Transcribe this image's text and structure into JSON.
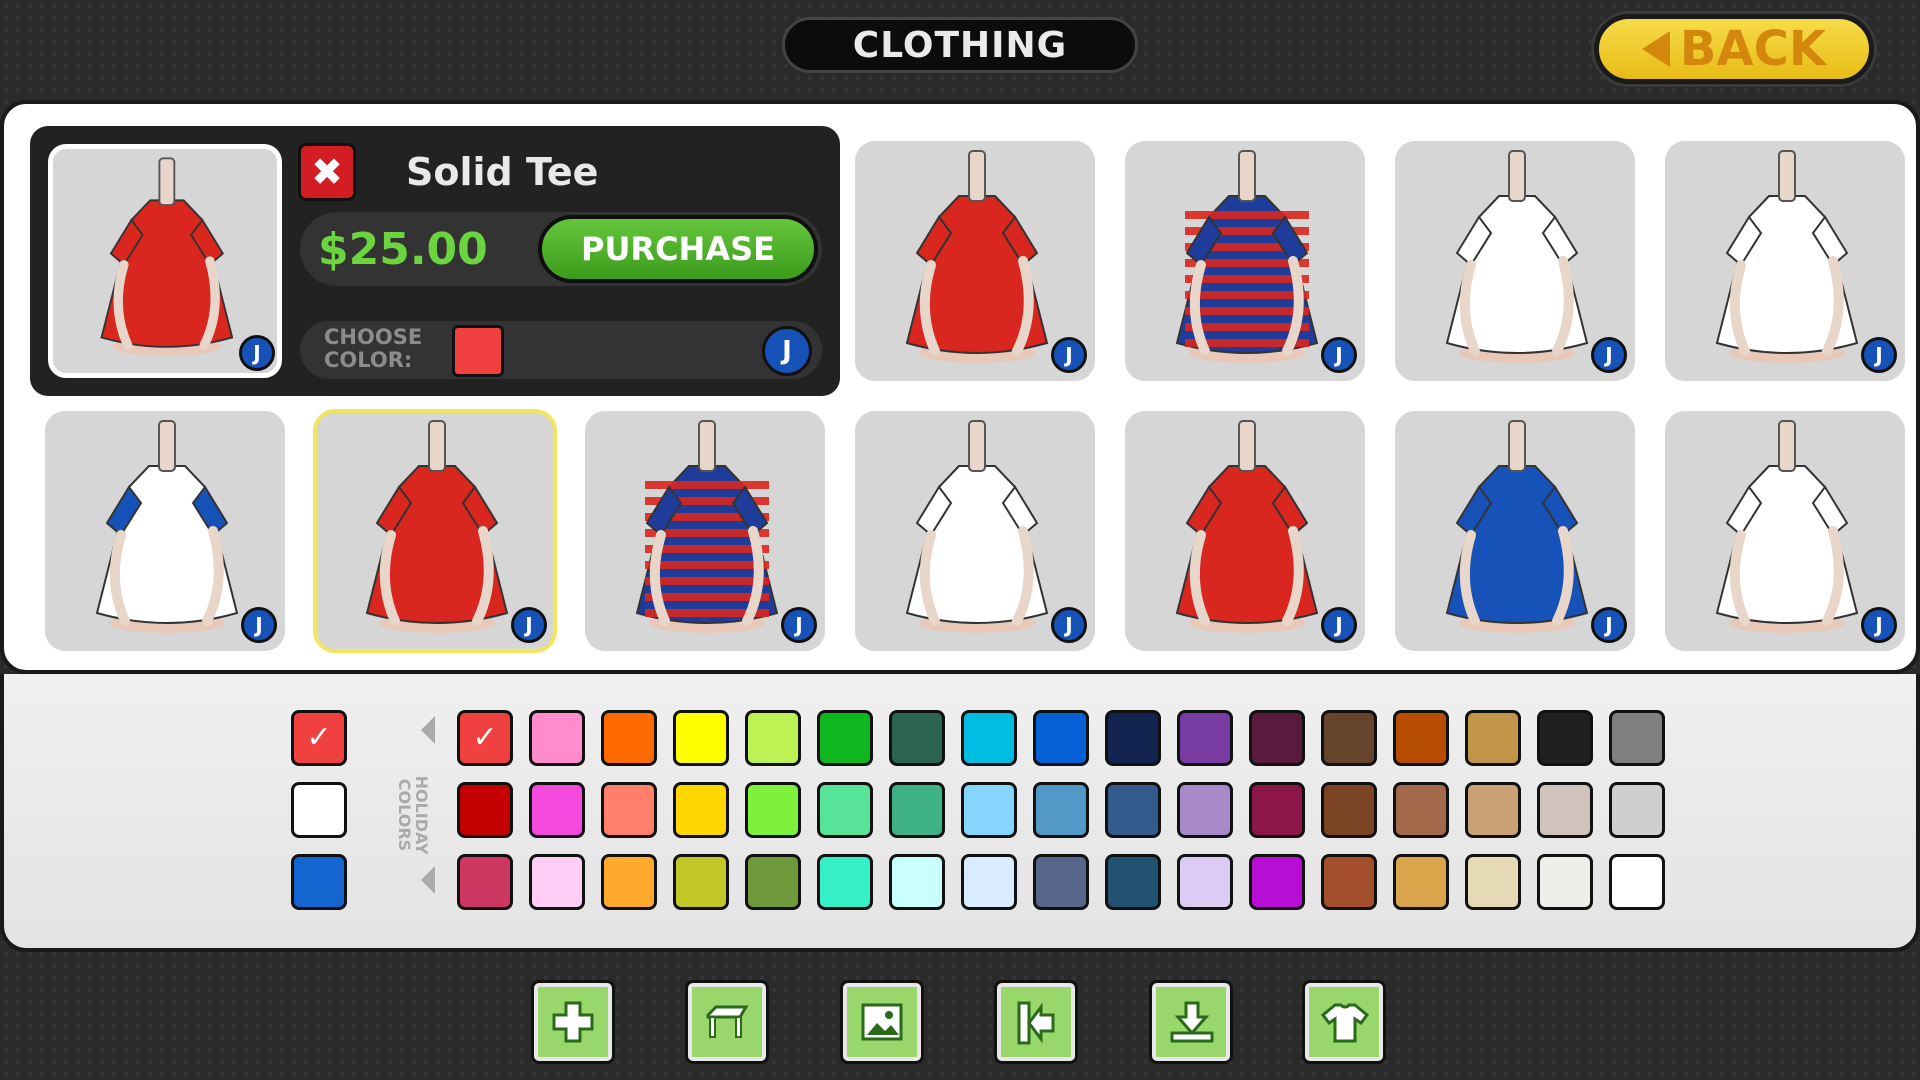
{
  "header": {
    "title": "CLOTHING",
    "back_label": "BACK"
  },
  "detail": {
    "item_name": "Solid Tee",
    "price": "$25.00",
    "purchase_label": "PURCHASE",
    "choose_color_label": "CHOOSE COLOR:",
    "badge": "J",
    "selected_color": "#f04040"
  },
  "shirts": [
    {
      "style": "solid-trim",
      "body": "#d9261e",
      "accent": "#ffffff",
      "stripe": false
    },
    {
      "style": "stripes",
      "body": "#1f3c9a",
      "accent": "#d9261e",
      "stripe": true
    },
    {
      "style": "vneck",
      "body": "#ffffff",
      "accent": "#1f3c9a",
      "stripe": false
    },
    {
      "style": "band",
      "body": "#ffffff",
      "accent": "#d9261e",
      "stripe": false
    },
    {
      "style": "raglan",
      "body": "#ffffff",
      "accent": "#1752b8",
      "stripe": false
    },
    {
      "style": "ringer",
      "body": "#d9261e",
      "accent": "#ffffff",
      "stripe": false
    },
    {
      "style": "rugby",
      "body": "#1f3c9a",
      "accent": "#d9261e",
      "stripe": true
    },
    {
      "style": "polo",
      "body": "#ffffff",
      "accent": "#ffffff",
      "stripe": false
    },
    {
      "style": "colorblock",
      "body": "#d9261e",
      "accent": "#ffffff",
      "stripe": false
    },
    {
      "style": "vneck-blue",
      "body": "#1752b8",
      "accent": "#d9261e",
      "stripe": false
    },
    {
      "style": "dash",
      "body": "#ffffff",
      "accent": "#1f3c9a",
      "stripe": false
    }
  ],
  "selected_shirt_index": 5,
  "custom_colors": [
    "#f04040",
    "#ffffff",
    "#1565d1"
  ],
  "holiday_label": "HOLIDAY COLORS",
  "palette": [
    [
      "#f04040",
      "#ff8ccd",
      "#ff6a00",
      "#ffff00",
      "#bdf255",
      "#0eb71e",
      "#2c6451",
      "#00bde2",
      "#0560d5",
      "#12244f",
      "#783ba1",
      "#5a1a3d",
      "#66442c",
      "#b64d00",
      "#c1954a",
      "#202020",
      "#7f7f7f"
    ],
    [
      "#c40000",
      "#f44add",
      "#ff806a",
      "#ffd700",
      "#7ef23a",
      "#57e398",
      "#3eb286",
      "#86d5ff",
      "#5399c7",
      "#345b8c",
      "#a88ac8",
      "#8c1648",
      "#7b4525",
      "#a2694a",
      "#c8a274",
      "#cfc3bb",
      "#cfcfcf"
    ],
    [
      "#cf3763",
      "#ffcdf6",
      "#ffaa2c",
      "#c1c726",
      "#70993b",
      "#35efc6",
      "#c9fffd",
      "#d8ebff",
      "#56658a",
      "#235270",
      "#dcccf5",
      "#b80dd4",
      "#a34f2c",
      "#d9a44a",
      "#e5dab5",
      "#eeeeeb",
      "#ffffff"
    ]
  ],
  "toolbar": [
    {
      "name": "add-button",
      "icon": "plus-icon"
    },
    {
      "name": "table-button",
      "icon": "table-icon"
    },
    {
      "name": "background-button",
      "icon": "picture-icon"
    },
    {
      "name": "exit-button",
      "icon": "exit-icon"
    },
    {
      "name": "save-button",
      "icon": "download-icon"
    },
    {
      "name": "clothing-button",
      "icon": "shirt-icon"
    }
  ]
}
